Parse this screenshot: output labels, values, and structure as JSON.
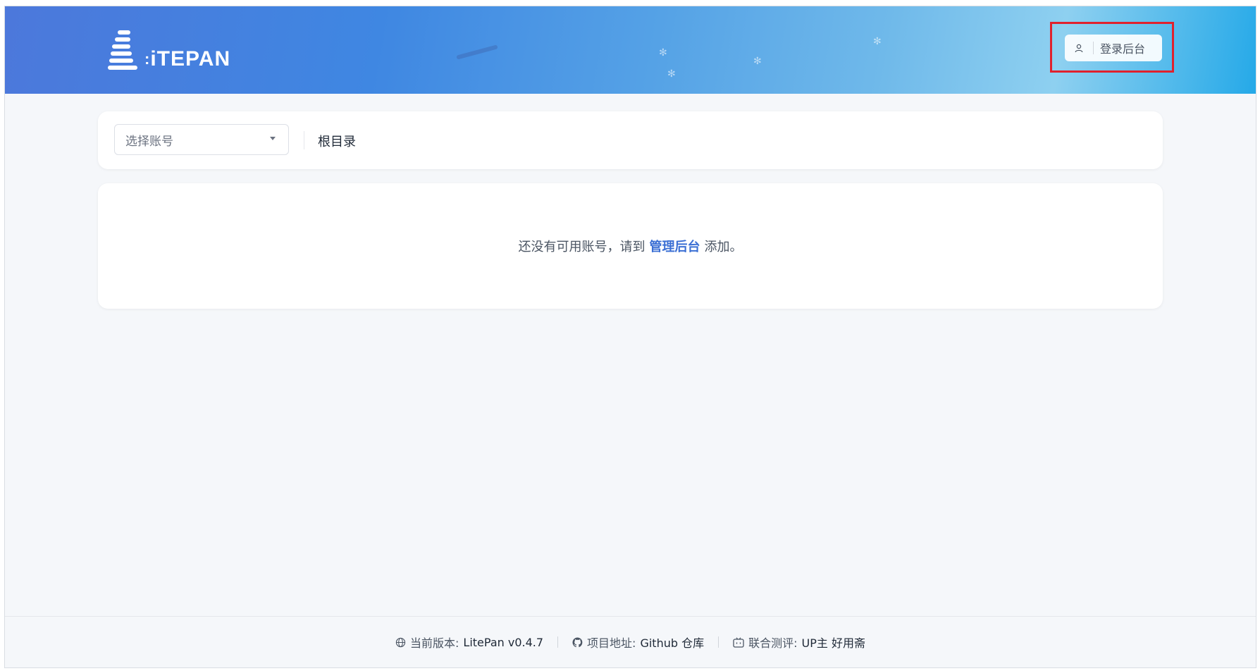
{
  "header": {
    "logo_text": "iTEPAN",
    "login_button_label": "登录后台"
  },
  "toolbar": {
    "account_select_placeholder": "选择账号",
    "breadcrumb_root": "根目录"
  },
  "empty_state": {
    "prefix": "还没有可用账号，请到",
    "link": "管理后台",
    "suffix": "添加。"
  },
  "footer": {
    "version_label": "当前版本:",
    "version_value": "LitePan v0.4.7",
    "repo_label": "项目地址:",
    "repo_value": "Github 仓库",
    "review_label": "联合测评:",
    "review_value": "UP主 好用斋"
  },
  "colors": {
    "accent": "#3b6fd4",
    "highlight_box": "#e0212d"
  }
}
